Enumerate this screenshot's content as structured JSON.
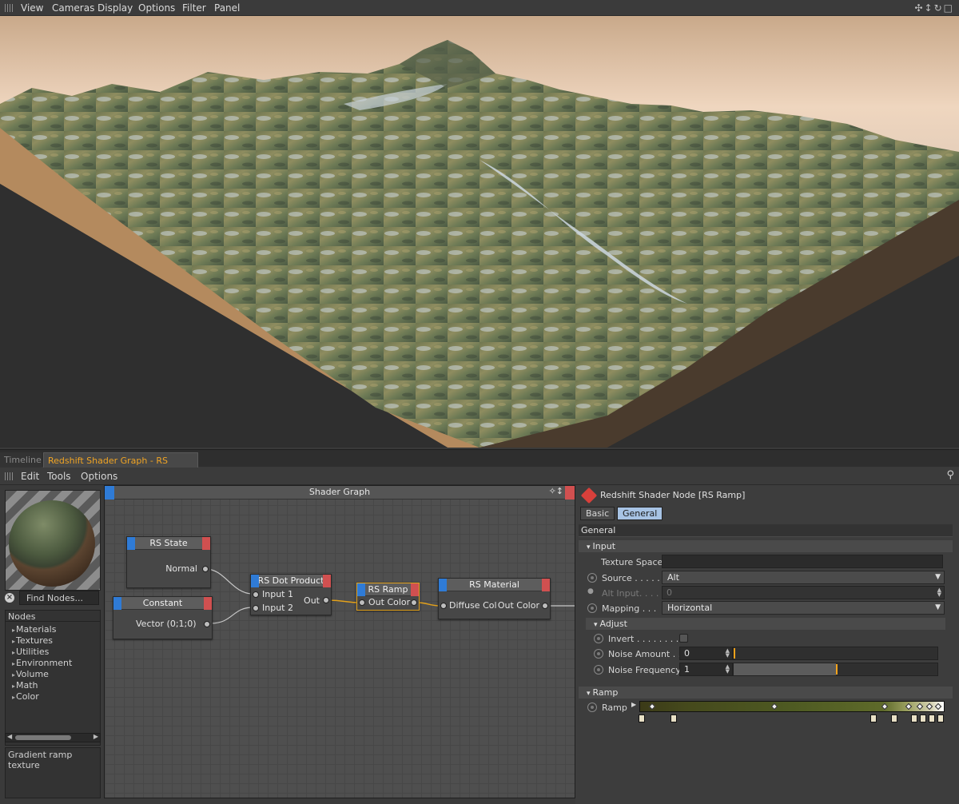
{
  "viewport": {
    "menu": [
      "View",
      "Cameras",
      "Display",
      "Options",
      "Filter",
      "Panel"
    ],
    "nav_icons": "✣↕↻□"
  },
  "panel_tabs": {
    "inactive": "Timeline",
    "active": "Redshift Shader Graph - RS Material"
  },
  "sub_menu": [
    "Edit",
    "Tools",
    "Options"
  ],
  "left": {
    "find_placeholder": "Find Nodes...",
    "nodes_title": "Nodes",
    "nodes": [
      "Materials",
      "Textures",
      "Utilities",
      "Environment",
      "Volume",
      "Math",
      "Color"
    ],
    "description": "Gradient ramp texture"
  },
  "graph": {
    "title": "Shader Graph",
    "nodes": {
      "rs_state": {
        "title": "RS State",
        "out": "Normal"
      },
      "constant": {
        "title": "Constant",
        "out": "Vector (0;1;0)"
      },
      "dot_product": {
        "title": "RS Dot Product",
        "in1": "Input 1",
        "in2": "Input 2",
        "out": "Out"
      },
      "ramp": {
        "title": "RS Ramp",
        "out": "Out Color"
      },
      "material": {
        "title": "RS Material",
        "in": "Diffuse Col",
        "out": "Out Color"
      }
    }
  },
  "attributes": {
    "title": "Redshift Shader Node [RS Ramp]",
    "tabs": {
      "basic": "Basic",
      "general": "General"
    },
    "section_general": "General",
    "section_input": "Input",
    "texture_space_label": "Texture Space",
    "source_label": "Source . . . . .",
    "source_value": "Alt",
    "alt_input_label": "Alt Input. . . .",
    "alt_input_value": "0",
    "mapping_label": "Mapping . . .",
    "mapping_value": "Horizontal",
    "section_adjust": "Adjust",
    "invert_label": "Invert . . . . . . . . .",
    "noise_amount_label": "Noise Amount . .",
    "noise_amount_value": "0",
    "noise_freq_label": "Noise Frequency",
    "noise_freq_value": "1",
    "section_ramp": "Ramp",
    "ramp_label": "Ramp"
  },
  "colors": {
    "accent_orange": "#f0a424",
    "node_in_blue": "#2f7bd6",
    "node_out_red": "#d05050",
    "tab_active_blue": "#a7c3e4"
  }
}
